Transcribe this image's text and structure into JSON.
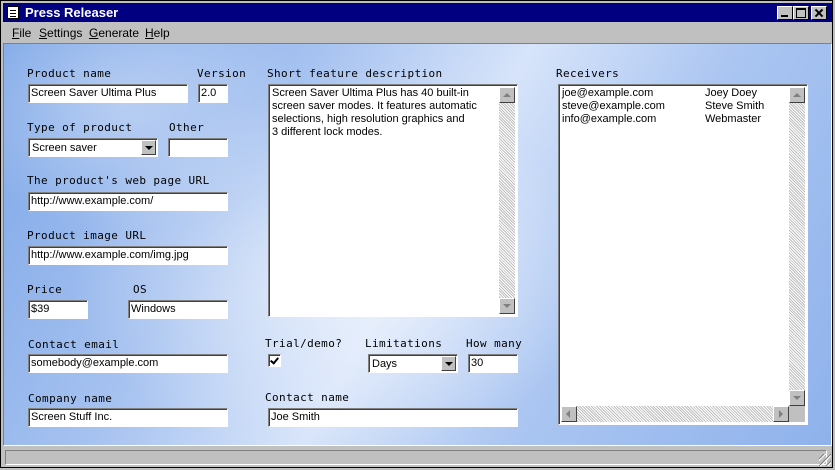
{
  "window": {
    "title": "Press Releaser"
  },
  "menu": [
    "File",
    "Settings",
    "Generate",
    "Help"
  ],
  "form": {
    "product_name": {
      "label": "Product name",
      "value": "Screen Saver Ultima Plus"
    },
    "version": {
      "label": "Version",
      "value": "2.0"
    },
    "type": {
      "label": "Type of product",
      "value": "Screen saver"
    },
    "other": {
      "label": "Other",
      "value": ""
    },
    "web_url": {
      "label": "The product's web page URL",
      "value": "http://www.example.com/"
    },
    "image_url": {
      "label": "Product image URL",
      "value": "http://www.example.com/img.jpg"
    },
    "price": {
      "label": "Price",
      "value": "$39"
    },
    "os": {
      "label": "OS",
      "value": "Windows"
    },
    "contact_email": {
      "label": "Contact email",
      "value": "somebody@example.com"
    },
    "company": {
      "label": "Company name",
      "value": "Screen Stuff Inc."
    },
    "description": {
      "label": "Short feature description",
      "lines": [
        "Screen Saver Ultima Plus has 40 built-in",
        "screen saver modes. It features automatic",
        "selections, high resolution graphics and",
        "3 different lock modes."
      ]
    },
    "trial": {
      "label": "Trial/demo?",
      "checked": true
    },
    "limitations": {
      "label": "Limitations",
      "value": "Days"
    },
    "how_many": {
      "label": "How many",
      "value": "30"
    },
    "contact_name": {
      "label": "Contact name",
      "value": "Joe Smith"
    }
  },
  "receivers": {
    "label": "Receivers",
    "items": [
      {
        "email": "joe@example.com",
        "name": "Joey Doey"
      },
      {
        "email": "steve@example.com",
        "name": "Steve Smith"
      },
      {
        "email": "info@example.com",
        "name": "Webmaster"
      }
    ]
  },
  "icons": {
    "app": "document-icon",
    "combo_arrow": "chevron-down-icon"
  }
}
